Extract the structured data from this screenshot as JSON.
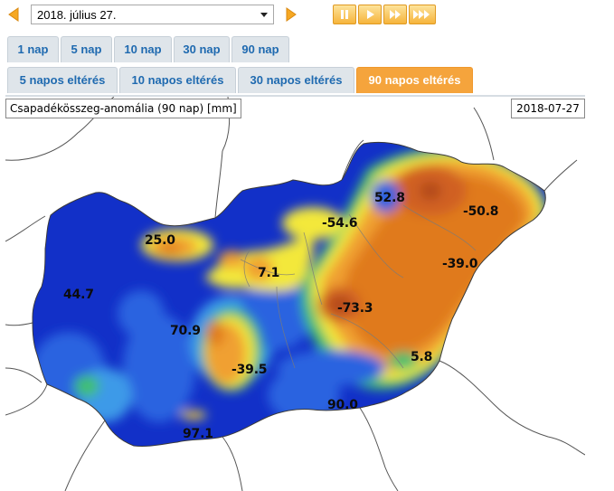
{
  "date_selector": {
    "selected": "2018. július 27."
  },
  "playback": {
    "buttons": [
      "pause",
      "play",
      "fast-forward",
      "fastest-forward"
    ]
  },
  "tabs_row1": [
    {
      "label": "1 nap"
    },
    {
      "label": "5 nap"
    },
    {
      "label": "10 nap"
    },
    {
      "label": "30 nap"
    },
    {
      "label": "90 nap"
    }
  ],
  "tabs_row2": [
    {
      "label": "5 napos eltérés"
    },
    {
      "label": "10 napos eltérés"
    },
    {
      "label": "30 napos eltérés"
    },
    {
      "label": "90 napos eltérés",
      "active": true
    }
  ],
  "map": {
    "title": "Csapadékösszeg-anomália (90 nap) [mm]",
    "date": "2018-07-27",
    "values": [
      "25.0",
      "44.7",
      "70.9",
      "7.1",
      "-39.5",
      "97.1",
      "90.0",
      "-54.6",
      "52.8",
      "-50.8",
      "-39.0",
      "-73.3",
      "5.8"
    ]
  },
  "colors": {
    "tab_bg": "#dfe5ea",
    "tab_text": "#1f6ab0",
    "tab_active_bg": "#f5a43c",
    "wet_deep": "#1230c8",
    "wet": "#2a63e0",
    "wet_light": "#3c9ae8",
    "green": "#3fbf6f",
    "yellow": "#f3e83a",
    "orange": "#f0a030",
    "dry": "#e07a1c",
    "dry_deep": "#b24a1e"
  }
}
